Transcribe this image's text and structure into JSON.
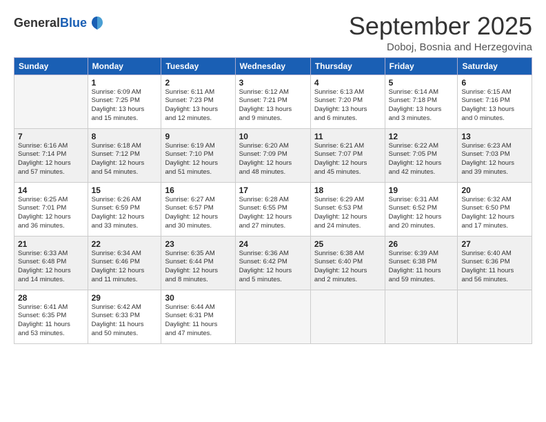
{
  "logo": {
    "general": "General",
    "blue": "Blue"
  },
  "title": "September 2025",
  "location": "Doboj, Bosnia and Herzegovina",
  "days_of_week": [
    "Sunday",
    "Monday",
    "Tuesday",
    "Wednesday",
    "Thursday",
    "Friday",
    "Saturday"
  ],
  "weeks": [
    [
      {
        "day": "",
        "info": ""
      },
      {
        "day": "1",
        "info": "Sunrise: 6:09 AM\nSunset: 7:25 PM\nDaylight: 13 hours\nand 15 minutes."
      },
      {
        "day": "2",
        "info": "Sunrise: 6:11 AM\nSunset: 7:23 PM\nDaylight: 13 hours\nand 12 minutes."
      },
      {
        "day": "3",
        "info": "Sunrise: 6:12 AM\nSunset: 7:21 PM\nDaylight: 13 hours\nand 9 minutes."
      },
      {
        "day": "4",
        "info": "Sunrise: 6:13 AM\nSunset: 7:20 PM\nDaylight: 13 hours\nand 6 minutes."
      },
      {
        "day": "5",
        "info": "Sunrise: 6:14 AM\nSunset: 7:18 PM\nDaylight: 13 hours\nand 3 minutes."
      },
      {
        "day": "6",
        "info": "Sunrise: 6:15 AM\nSunset: 7:16 PM\nDaylight: 13 hours\nand 0 minutes."
      }
    ],
    [
      {
        "day": "7",
        "info": "Sunrise: 6:16 AM\nSunset: 7:14 PM\nDaylight: 12 hours\nand 57 minutes."
      },
      {
        "day": "8",
        "info": "Sunrise: 6:18 AM\nSunset: 7:12 PM\nDaylight: 12 hours\nand 54 minutes."
      },
      {
        "day": "9",
        "info": "Sunrise: 6:19 AM\nSunset: 7:10 PM\nDaylight: 12 hours\nand 51 minutes."
      },
      {
        "day": "10",
        "info": "Sunrise: 6:20 AM\nSunset: 7:09 PM\nDaylight: 12 hours\nand 48 minutes."
      },
      {
        "day": "11",
        "info": "Sunrise: 6:21 AM\nSunset: 7:07 PM\nDaylight: 12 hours\nand 45 minutes."
      },
      {
        "day": "12",
        "info": "Sunrise: 6:22 AM\nSunset: 7:05 PM\nDaylight: 12 hours\nand 42 minutes."
      },
      {
        "day": "13",
        "info": "Sunrise: 6:23 AM\nSunset: 7:03 PM\nDaylight: 12 hours\nand 39 minutes."
      }
    ],
    [
      {
        "day": "14",
        "info": "Sunrise: 6:25 AM\nSunset: 7:01 PM\nDaylight: 12 hours\nand 36 minutes."
      },
      {
        "day": "15",
        "info": "Sunrise: 6:26 AM\nSunset: 6:59 PM\nDaylight: 12 hours\nand 33 minutes."
      },
      {
        "day": "16",
        "info": "Sunrise: 6:27 AM\nSunset: 6:57 PM\nDaylight: 12 hours\nand 30 minutes."
      },
      {
        "day": "17",
        "info": "Sunrise: 6:28 AM\nSunset: 6:55 PM\nDaylight: 12 hours\nand 27 minutes."
      },
      {
        "day": "18",
        "info": "Sunrise: 6:29 AM\nSunset: 6:53 PM\nDaylight: 12 hours\nand 24 minutes."
      },
      {
        "day": "19",
        "info": "Sunrise: 6:31 AM\nSunset: 6:52 PM\nDaylight: 12 hours\nand 20 minutes."
      },
      {
        "day": "20",
        "info": "Sunrise: 6:32 AM\nSunset: 6:50 PM\nDaylight: 12 hours\nand 17 minutes."
      }
    ],
    [
      {
        "day": "21",
        "info": "Sunrise: 6:33 AM\nSunset: 6:48 PM\nDaylight: 12 hours\nand 14 minutes."
      },
      {
        "day": "22",
        "info": "Sunrise: 6:34 AM\nSunset: 6:46 PM\nDaylight: 12 hours\nand 11 minutes."
      },
      {
        "day": "23",
        "info": "Sunrise: 6:35 AM\nSunset: 6:44 PM\nDaylight: 12 hours\nand 8 minutes."
      },
      {
        "day": "24",
        "info": "Sunrise: 6:36 AM\nSunset: 6:42 PM\nDaylight: 12 hours\nand 5 minutes."
      },
      {
        "day": "25",
        "info": "Sunrise: 6:38 AM\nSunset: 6:40 PM\nDaylight: 12 hours\nand 2 minutes."
      },
      {
        "day": "26",
        "info": "Sunrise: 6:39 AM\nSunset: 6:38 PM\nDaylight: 11 hours\nand 59 minutes."
      },
      {
        "day": "27",
        "info": "Sunrise: 6:40 AM\nSunset: 6:36 PM\nDaylight: 11 hours\nand 56 minutes."
      }
    ],
    [
      {
        "day": "28",
        "info": "Sunrise: 6:41 AM\nSunset: 6:35 PM\nDaylight: 11 hours\nand 53 minutes."
      },
      {
        "day": "29",
        "info": "Sunrise: 6:42 AM\nSunset: 6:33 PM\nDaylight: 11 hours\nand 50 minutes."
      },
      {
        "day": "30",
        "info": "Sunrise: 6:44 AM\nSunset: 6:31 PM\nDaylight: 11 hours\nand 47 minutes."
      },
      {
        "day": "",
        "info": ""
      },
      {
        "day": "",
        "info": ""
      },
      {
        "day": "",
        "info": ""
      },
      {
        "day": "",
        "info": ""
      }
    ]
  ]
}
